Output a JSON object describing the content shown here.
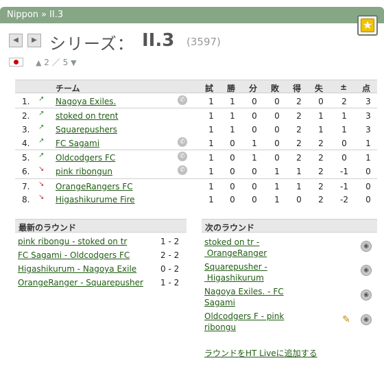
{
  "breadcrumb": {
    "country": "Nippon",
    "separator": "»",
    "league": "II.3"
  },
  "header": {
    "series_label": "シリーズ：",
    "league_name": "II.3",
    "league_id": "(3597)"
  },
  "pager": {
    "up_icon": "▲",
    "current": "2",
    "separator": "／",
    "total": "5",
    "down_icon": "▼"
  },
  "table": {
    "columns": {
      "team": "チーム",
      "played": "試",
      "won": "勝",
      "draw": "分",
      "lost": "敗",
      "gf": "得",
      "ga": "失",
      "diff": "±",
      "points": "点"
    },
    "rows": [
      {
        "pos": "1.",
        "trend": "up",
        "team": "Nagoya Exiles.",
        "mobile": true,
        "played": "1",
        "won": "1",
        "draw": "0",
        "lost": "0",
        "gf": "2",
        "ga": "0",
        "diff": "2",
        "points": "3"
      },
      {
        "pos": "2.",
        "trend": "up",
        "team": "stoked on trent",
        "mobile": false,
        "played": "1",
        "won": "1",
        "draw": "0",
        "lost": "0",
        "gf": "2",
        "ga": "1",
        "diff": "1",
        "points": "3"
      },
      {
        "pos": "3.",
        "trend": "up",
        "team": "Squarepushers",
        "mobile": false,
        "played": "1",
        "won": "1",
        "draw": "0",
        "lost": "0",
        "gf": "2",
        "ga": "1",
        "diff": "1",
        "points": "3"
      },
      {
        "pos": "4.",
        "trend": "up",
        "team": "FC Sagami",
        "mobile": true,
        "played": "1",
        "won": "0",
        "draw": "1",
        "lost": "0",
        "gf": "2",
        "ga": "2",
        "diff": "0",
        "points": "1"
      },
      {
        "pos": "5.",
        "trend": "up",
        "team": "Oldcodgers FC",
        "mobile": true,
        "played": "1",
        "won": "0",
        "draw": "1",
        "lost": "0",
        "gf": "2",
        "ga": "2",
        "diff": "0",
        "points": "1"
      },
      {
        "pos": "6.",
        "trend": "down",
        "team": "pink ribongun",
        "mobile": true,
        "played": "1",
        "won": "0",
        "draw": "0",
        "lost": "1",
        "gf": "1",
        "ga": "2",
        "diff": "-1",
        "points": "0"
      },
      {
        "pos": "7.",
        "trend": "down",
        "team": "OrangeRangers FC",
        "mobile": false,
        "played": "1",
        "won": "0",
        "draw": "0",
        "lost": "1",
        "gf": "1",
        "ga": "2",
        "diff": "-1",
        "points": "0"
      },
      {
        "pos": "8.",
        "trend": "down",
        "team": "Higashikurume Fire",
        "mobile": false,
        "played": "1",
        "won": "0",
        "draw": "0",
        "lost": "1",
        "gf": "0",
        "ga": "2",
        "diff": "-2",
        "points": "0"
      }
    ]
  },
  "latest_round": {
    "title": "最新のラウンド",
    "matches": [
      {
        "teams": "pink ribongu - stoked on tr",
        "score": "1 - 2"
      },
      {
        "teams": "FC Sagami - Oldcodgers FC",
        "score": "2 - 2"
      },
      {
        "teams": "Higashikurum - Nagoya Exile",
        "score": "0 - 2"
      },
      {
        "teams": "OrangeRanger - Squarepusher",
        "score": "1 - 2"
      }
    ]
  },
  "next_round": {
    "title": "次のラウンド",
    "matches": [
      {
        "line1": "stoked on tr -",
        "line2": "OrangeRanger"
      },
      {
        "line1": "Squarepusher -",
        "line2": "Higashikurum"
      },
      {
        "line1": "Nagoya Exiles. - FC",
        "line2": "Sagami"
      },
      {
        "line1": "Oldcodgers F - pink",
        "line2": "ribongu"
      }
    ],
    "ht_live_link": "ラウンドをHT Liveに追加する"
  },
  "icons": {
    "prev": "◀",
    "next": "▶",
    "star": "★",
    "arrow_up": "↗",
    "arrow_down": "↘"
  },
  "colors": {
    "header_bar": "#86a686",
    "link": "#1f5c12",
    "trend_up": "#2a8a2a",
    "trend_down": "#c03030"
  }
}
